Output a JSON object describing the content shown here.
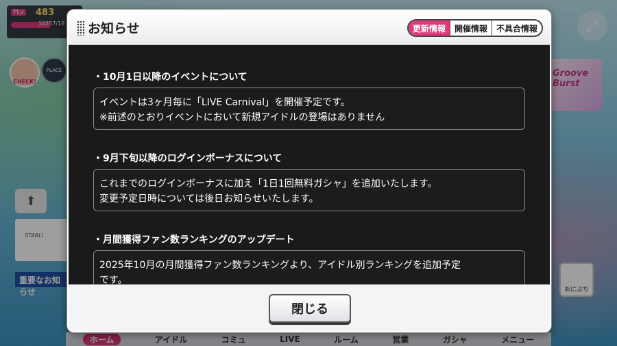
{
  "background": {
    "player_level_tag": "PLv",
    "player_level": "483",
    "exp_text": "10257/18",
    "exp_fraction": 0.57,
    "check_label": "CHECK!",
    "place_label": "PLACE",
    "starlight_label": "STARLI",
    "important_label": "重要なお知らせ",
    "groove_label": "Groove Burst",
    "anipuchi_label": "あにぷち",
    "nav": [
      "ホーム",
      "アイドル",
      "コミュ",
      "LIVE",
      "ルーム",
      "営業",
      "ガシャ",
      "メニュー"
    ]
  },
  "dialog": {
    "title": "お知らせ",
    "tabs": [
      {
        "label": "更新情報",
        "active": true
      },
      {
        "label": "開催情報",
        "active": false
      },
      {
        "label": "不具合情報",
        "active": false
      }
    ],
    "sections": [
      {
        "title": "・10月1日以降のイベントについて",
        "lines": [
          "イベントは3ヶ月毎に「LIVE Carnival」を開催予定です。",
          "※前述のとおりイベントにおいて新規アイドルの登場はありません"
        ]
      },
      {
        "title": "・9月下旬以降のログインボーナスについて",
        "lines": [
          "これまでのログインボーナスに加え「1日1回無料ガシャ」を追加いたします。",
          "変更予定日時については後日お知らせいたします。"
        ]
      },
      {
        "title": "・月間獲得ファン数ランキングのアップデート",
        "lines": [
          "2025年10月の月間獲得ファン数ランキングより、アイドル別ランキングを追加予定",
          "です。"
        ]
      }
    ],
    "close_label": "閉じる"
  },
  "colors": {
    "accent": "#e0397f",
    "body_bg": "#1a1a1a",
    "header_bg": "#f4f4f6"
  }
}
